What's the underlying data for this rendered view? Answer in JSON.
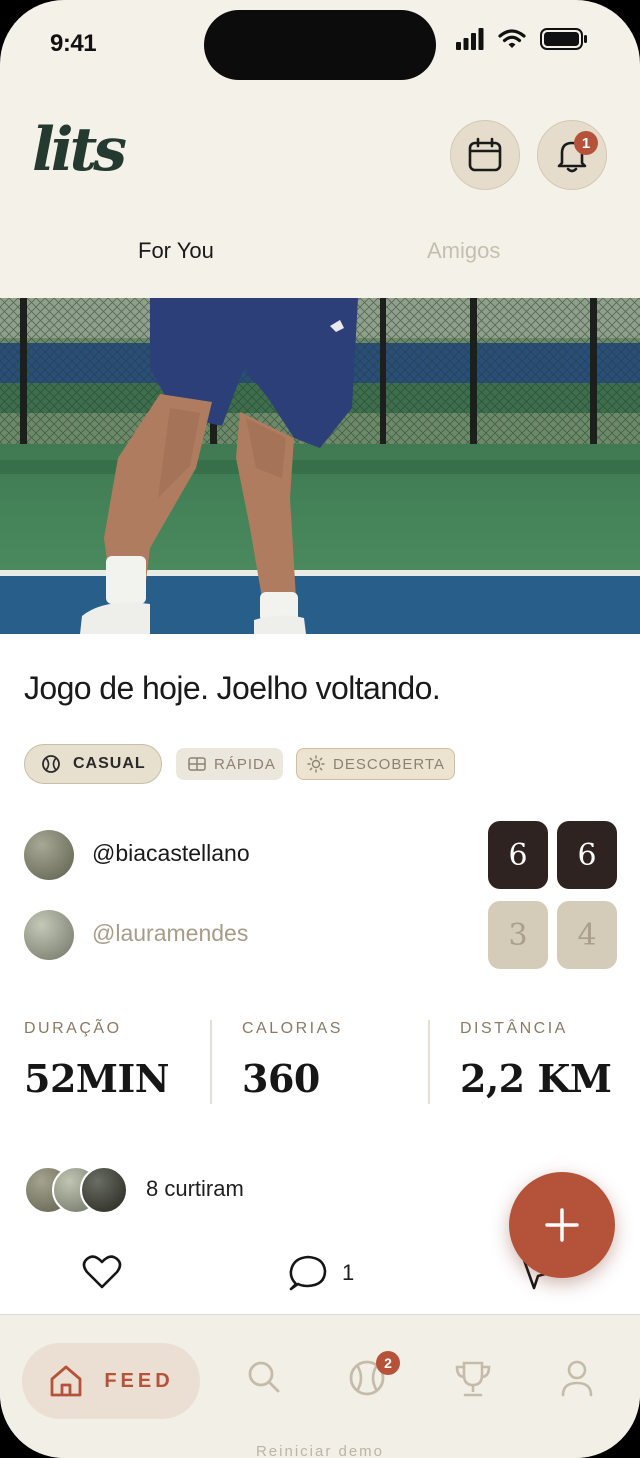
{
  "status": {
    "time": "9:41"
  },
  "app": {
    "logo_text": "lits"
  },
  "header": {
    "notification_count": "1"
  },
  "tabs": [
    {
      "label": "For You",
      "active": true
    },
    {
      "label": "Amigos",
      "active": false
    }
  ],
  "post": {
    "title": "Jogo de hoje. Joelho voltando.",
    "tags": [
      {
        "label": "CASUAL",
        "icon": "racket-icon",
        "selected": true
      },
      {
        "label": "RÁPIDA",
        "icon": "grid-icon",
        "selected": false
      },
      {
        "label": "DESCOBERTA",
        "icon": "sun-icon",
        "selected": false
      }
    ],
    "players": [
      {
        "handle": "@biacastellano",
        "scores": [
          "6",
          "6"
        ],
        "winner": true
      },
      {
        "handle": "@lauramendes",
        "scores": [
          "3",
          "4"
        ],
        "winner": false
      }
    ],
    "stats": [
      {
        "label": "DURAÇÃO",
        "value": "52MIN"
      },
      {
        "label": "CALORIAS",
        "value": "360"
      },
      {
        "label": "DISTÂNCIA",
        "value": "2,2 KM"
      }
    ],
    "likes_text": "8 curtiram",
    "comment_count": "1"
  },
  "nav": {
    "items": [
      {
        "label": "FEED",
        "icon": "home-icon",
        "active": true
      },
      {
        "label": "",
        "icon": "search-icon",
        "active": false
      },
      {
        "label": "",
        "icon": "tennis-ball-icon",
        "active": false,
        "badge": "2"
      },
      {
        "label": "",
        "icon": "trophy-icon",
        "active": false
      },
      {
        "label": "",
        "icon": "profile-icon",
        "active": false
      }
    ],
    "reset_label": "Reiniciar demo"
  },
  "colors": {
    "background": "#f4f1e8",
    "accent": "#b5533a",
    "dark": "#2e2320",
    "muted": "#c9bfae",
    "logo": "#243a30"
  }
}
